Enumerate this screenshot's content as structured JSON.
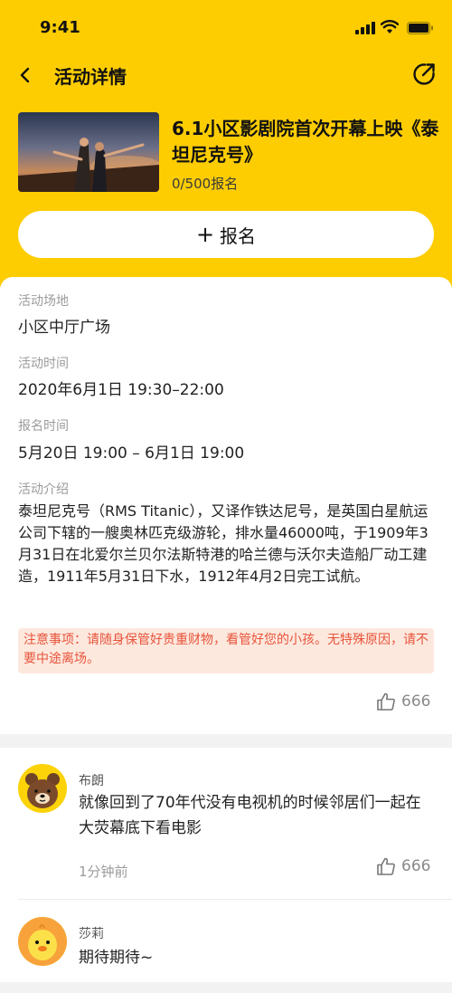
{
  "status_bar": {
    "time": "9:41"
  },
  "nav": {
    "title": "活动详情"
  },
  "event": {
    "title": "6.1小区影剧院首次开幕上映《泰坦尼克号》",
    "count": "0/500报名",
    "signup_plus": "+",
    "signup_label": "报名"
  },
  "details": {
    "venue_label": "活动场地",
    "venue": "小区中厅广场",
    "time_label": "活动时间",
    "time": "2020年6月1日  19:30–22:00",
    "signup_time_label": "报名时间",
    "signup_time": "5月20日 19:00  –  6月1日 19:00",
    "intro_label": "活动介绍",
    "intro": "泰坦尼克号（RMS Titanic），又译作铁达尼号，是英国白星航运公司下辖的一艘奥林匹克级游轮，排水量46000吨，于1909年3月31日在北爱尔兰贝尔法斯特港的哈兰德与沃尔夫造船厂动工建造，1911年5月31日下水，1912年4月2日完工试航。",
    "notice": "注意事项：请随身保管好贵重财物，看管好您的小孩。无特殊原因，请不要中途离场。",
    "likes": "666"
  },
  "comments": [
    {
      "name": "布朗",
      "text": "就像回到了70年代没有电视机的时候邻居们一起在大荧幕底下看电影",
      "time": "1分钟前",
      "likes": "666",
      "avatar": "brown-bear-avatar"
    },
    {
      "name": "莎莉",
      "text": "期待期待~",
      "avatar": "sally-chick-avatar"
    }
  ],
  "colors": {
    "brand_yellow": "#fdcd02",
    "notice_bg": "#fde8de",
    "notice_text": "#e8543a"
  }
}
